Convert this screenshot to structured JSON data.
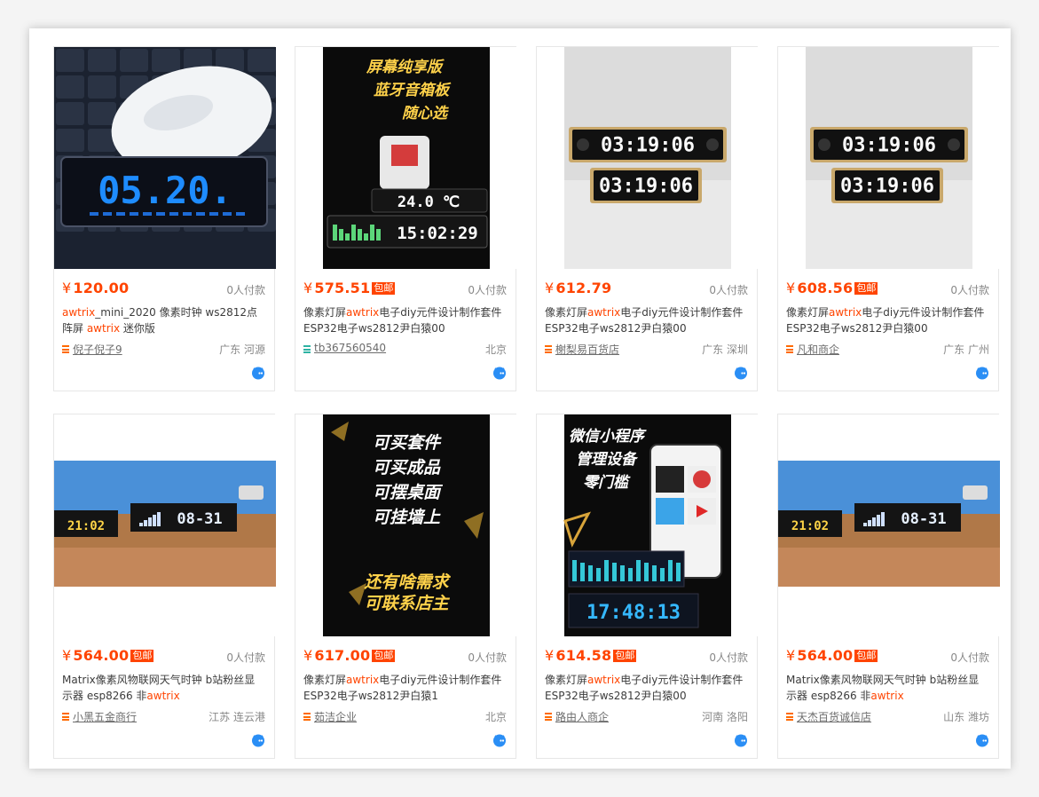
{
  "items": [
    {
      "price": "120.00",
      "baoyou": "",
      "paid": "0人付款",
      "title": [
        {
          "t": "awtrix",
          "hl": true
        },
        {
          "t": "_mini_2020 像素时钟 ws2812点阵屏 ",
          "hl": false
        },
        {
          "t": "awtrix",
          "hl": true
        },
        {
          "t": " 迷你版",
          "hl": false
        }
      ],
      "shop": "倪子倪子9",
      "shop_icon": "orange",
      "location": "广东 河源",
      "image": "mouse-clock",
      "clock_text": "05.20."
    },
    {
      "price": "575.51",
      "baoyou": "包邮",
      "paid": "0人付款",
      "title": [
        {
          "t": "像素灯屏",
          "hl": false
        },
        {
          "t": "awtrix",
          "hl": true
        },
        {
          "t": "电子diy元件设计制作套件ESP32电子ws2812尹白猿00",
          "hl": false
        }
      ],
      "shop": "tb367560540",
      "shop_icon": "teal",
      "location": "北京",
      "image": "poster-gundam",
      "poster_lines": [
        "屏幕纯享版",
        "蓝牙音箱板",
        "随心选"
      ],
      "clock_text": "15:02:29",
      "temp_text": "24.0 ℃"
    },
    {
      "price": "612.79",
      "baoyou": "",
      "paid": "0人付款",
      "title": [
        {
          "t": "像素灯屏",
          "hl": false
        },
        {
          "t": "awtrix",
          "hl": true
        },
        {
          "t": "电子diy元件设计制作套件ESP32电子ws2812尹白猿00",
          "hl": false
        }
      ],
      "shop": "榭梨易百货店",
      "shop_icon": "orange",
      "location": "广东 深圳",
      "image": "twin-clocks",
      "clock_text": "03:19:06"
    },
    {
      "price": "608.56",
      "baoyou": "包邮",
      "paid": "0人付款",
      "title": [
        {
          "t": "像素灯屏",
          "hl": false
        },
        {
          "t": "awtrix",
          "hl": true
        },
        {
          "t": "电子diy元件设计制作套件ESP32电子ws2812尹白猿00",
          "hl": false
        }
      ],
      "shop": "凡和商企",
      "shop_icon": "orange",
      "location": "广东 广州",
      "image": "twin-clocks",
      "clock_text": "03:19:06"
    },
    {
      "price": "564.00",
      "baoyou": "包邮",
      "paid": "0人付款",
      "title": [
        {
          "t": "Matrix像素风物联网天气时钟 b站粉丝显示器 esp8266 非",
          "hl": false
        },
        {
          "t": "awtrix",
          "hl": true
        }
      ],
      "shop": "小黑五金商行",
      "shop_icon": "orange",
      "location": "江苏 连云港",
      "image": "desk-clock",
      "clock_text": "08-31",
      "small_clock": "21:02"
    },
    {
      "price": "617.00",
      "baoyou": "包邮",
      "paid": "0人付款",
      "title": [
        {
          "t": "像素灯屏",
          "hl": false
        },
        {
          "t": "awtrix",
          "hl": true
        },
        {
          "t": "电子diy元件设计制作套件ESP32电子ws2812尹白猿1",
          "hl": false
        }
      ],
      "shop": "茹洁企业",
      "shop_icon": "orange",
      "location": "北京",
      "image": "poster-text",
      "poster_lines": [
        "可买套件",
        "可买成品",
        "可摆桌面",
        "可挂墙上",
        "还有啥需求",
        "可联系店主"
      ]
    },
    {
      "price": "614.58",
      "baoyou": "包邮",
      "paid": "0人付款",
      "title": [
        {
          "t": "像素灯屏",
          "hl": false
        },
        {
          "t": "awtrix",
          "hl": true
        },
        {
          "t": "电子diy元件设计制作套件ESP32电子ws2812尹白猿00",
          "hl": false
        }
      ],
      "shop": "路由人商企",
      "shop_icon": "orange",
      "location": "河南 洛阳",
      "image": "poster-app",
      "poster_lines": [
        "微信小程序",
        "管理设备",
        "零门槛"
      ],
      "clock_text": "17:48:13"
    },
    {
      "price": "564.00",
      "baoyou": "包邮",
      "paid": "0人付款",
      "title": [
        {
          "t": "Matrix像素风物联网天气时钟 b站粉丝显示器 esp8266 非",
          "hl": false
        },
        {
          "t": "awtrix",
          "hl": true
        }
      ],
      "shop": "天杰百货诚信店",
      "shop_icon": "orange",
      "location": "山东 潍坊",
      "image": "desk-clock",
      "clock_text": "08-31",
      "small_clock": "21:02"
    }
  ],
  "currency": "¥",
  "icons": {
    "shop": "shop-list-icon",
    "chat": "wangwang-chat-icon"
  },
  "colors": {
    "accent": "#ff4400",
    "panel": "#ffffff"
  }
}
